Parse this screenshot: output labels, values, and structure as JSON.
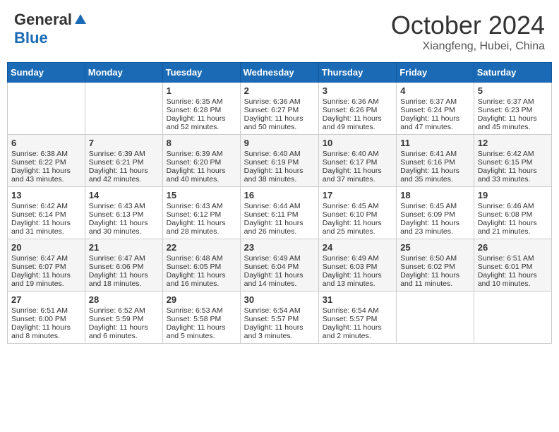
{
  "header": {
    "logo_general": "General",
    "logo_blue": "Blue",
    "month_title": "October 2024",
    "location": "Xiangfeng, Hubei, China"
  },
  "days_of_week": [
    "Sunday",
    "Monday",
    "Tuesday",
    "Wednesday",
    "Thursday",
    "Friday",
    "Saturday"
  ],
  "weeks": [
    [
      {
        "day": "",
        "sunrise": "",
        "sunset": "",
        "daylight": ""
      },
      {
        "day": "",
        "sunrise": "",
        "sunset": "",
        "daylight": ""
      },
      {
        "day": "1",
        "sunrise": "Sunrise: 6:35 AM",
        "sunset": "Sunset: 6:28 PM",
        "daylight": "Daylight: 11 hours and 52 minutes."
      },
      {
        "day": "2",
        "sunrise": "Sunrise: 6:36 AM",
        "sunset": "Sunset: 6:27 PM",
        "daylight": "Daylight: 11 hours and 50 minutes."
      },
      {
        "day": "3",
        "sunrise": "Sunrise: 6:36 AM",
        "sunset": "Sunset: 6:26 PM",
        "daylight": "Daylight: 11 hours and 49 minutes."
      },
      {
        "day": "4",
        "sunrise": "Sunrise: 6:37 AM",
        "sunset": "Sunset: 6:24 PM",
        "daylight": "Daylight: 11 hours and 47 minutes."
      },
      {
        "day": "5",
        "sunrise": "Sunrise: 6:37 AM",
        "sunset": "Sunset: 6:23 PM",
        "daylight": "Daylight: 11 hours and 45 minutes."
      }
    ],
    [
      {
        "day": "6",
        "sunrise": "Sunrise: 6:38 AM",
        "sunset": "Sunset: 6:22 PM",
        "daylight": "Daylight: 11 hours and 43 minutes."
      },
      {
        "day": "7",
        "sunrise": "Sunrise: 6:39 AM",
        "sunset": "Sunset: 6:21 PM",
        "daylight": "Daylight: 11 hours and 42 minutes."
      },
      {
        "day": "8",
        "sunrise": "Sunrise: 6:39 AM",
        "sunset": "Sunset: 6:20 PM",
        "daylight": "Daylight: 11 hours and 40 minutes."
      },
      {
        "day": "9",
        "sunrise": "Sunrise: 6:40 AM",
        "sunset": "Sunset: 6:19 PM",
        "daylight": "Daylight: 11 hours and 38 minutes."
      },
      {
        "day": "10",
        "sunrise": "Sunrise: 6:40 AM",
        "sunset": "Sunset: 6:17 PM",
        "daylight": "Daylight: 11 hours and 37 minutes."
      },
      {
        "day": "11",
        "sunrise": "Sunrise: 6:41 AM",
        "sunset": "Sunset: 6:16 PM",
        "daylight": "Daylight: 11 hours and 35 minutes."
      },
      {
        "day": "12",
        "sunrise": "Sunrise: 6:42 AM",
        "sunset": "Sunset: 6:15 PM",
        "daylight": "Daylight: 11 hours and 33 minutes."
      }
    ],
    [
      {
        "day": "13",
        "sunrise": "Sunrise: 6:42 AM",
        "sunset": "Sunset: 6:14 PM",
        "daylight": "Daylight: 11 hours and 31 minutes."
      },
      {
        "day": "14",
        "sunrise": "Sunrise: 6:43 AM",
        "sunset": "Sunset: 6:13 PM",
        "daylight": "Daylight: 11 hours and 30 minutes."
      },
      {
        "day": "15",
        "sunrise": "Sunrise: 6:43 AM",
        "sunset": "Sunset: 6:12 PM",
        "daylight": "Daylight: 11 hours and 28 minutes."
      },
      {
        "day": "16",
        "sunrise": "Sunrise: 6:44 AM",
        "sunset": "Sunset: 6:11 PM",
        "daylight": "Daylight: 11 hours and 26 minutes."
      },
      {
        "day": "17",
        "sunrise": "Sunrise: 6:45 AM",
        "sunset": "Sunset: 6:10 PM",
        "daylight": "Daylight: 11 hours and 25 minutes."
      },
      {
        "day": "18",
        "sunrise": "Sunrise: 6:45 AM",
        "sunset": "Sunset: 6:09 PM",
        "daylight": "Daylight: 11 hours and 23 minutes."
      },
      {
        "day": "19",
        "sunrise": "Sunrise: 6:46 AM",
        "sunset": "Sunset: 6:08 PM",
        "daylight": "Daylight: 11 hours and 21 minutes."
      }
    ],
    [
      {
        "day": "20",
        "sunrise": "Sunrise: 6:47 AM",
        "sunset": "Sunset: 6:07 PM",
        "daylight": "Daylight: 11 hours and 19 minutes."
      },
      {
        "day": "21",
        "sunrise": "Sunrise: 6:47 AM",
        "sunset": "Sunset: 6:06 PM",
        "daylight": "Daylight: 11 hours and 18 minutes."
      },
      {
        "day": "22",
        "sunrise": "Sunrise: 6:48 AM",
        "sunset": "Sunset: 6:05 PM",
        "daylight": "Daylight: 11 hours and 16 minutes."
      },
      {
        "day": "23",
        "sunrise": "Sunrise: 6:49 AM",
        "sunset": "Sunset: 6:04 PM",
        "daylight": "Daylight: 11 hours and 14 minutes."
      },
      {
        "day": "24",
        "sunrise": "Sunrise: 6:49 AM",
        "sunset": "Sunset: 6:03 PM",
        "daylight": "Daylight: 11 hours and 13 minutes."
      },
      {
        "day": "25",
        "sunrise": "Sunrise: 6:50 AM",
        "sunset": "Sunset: 6:02 PM",
        "daylight": "Daylight: 11 hours and 11 minutes."
      },
      {
        "day": "26",
        "sunrise": "Sunrise: 6:51 AM",
        "sunset": "Sunset: 6:01 PM",
        "daylight": "Daylight: 11 hours and 10 minutes."
      }
    ],
    [
      {
        "day": "27",
        "sunrise": "Sunrise: 6:51 AM",
        "sunset": "Sunset: 6:00 PM",
        "daylight": "Daylight: 11 hours and 8 minutes."
      },
      {
        "day": "28",
        "sunrise": "Sunrise: 6:52 AM",
        "sunset": "Sunset: 5:59 PM",
        "daylight": "Daylight: 11 hours and 6 minutes."
      },
      {
        "day": "29",
        "sunrise": "Sunrise: 6:53 AM",
        "sunset": "Sunset: 5:58 PM",
        "daylight": "Daylight: 11 hours and 5 minutes."
      },
      {
        "day": "30",
        "sunrise": "Sunrise: 6:54 AM",
        "sunset": "Sunset: 5:57 PM",
        "daylight": "Daylight: 11 hours and 3 minutes."
      },
      {
        "day": "31",
        "sunrise": "Sunrise: 6:54 AM",
        "sunset": "Sunset: 5:57 PM",
        "daylight": "Daylight: 11 hours and 2 minutes."
      },
      {
        "day": "",
        "sunrise": "",
        "sunset": "",
        "daylight": ""
      },
      {
        "day": "",
        "sunrise": "",
        "sunset": "",
        "daylight": ""
      }
    ]
  ]
}
